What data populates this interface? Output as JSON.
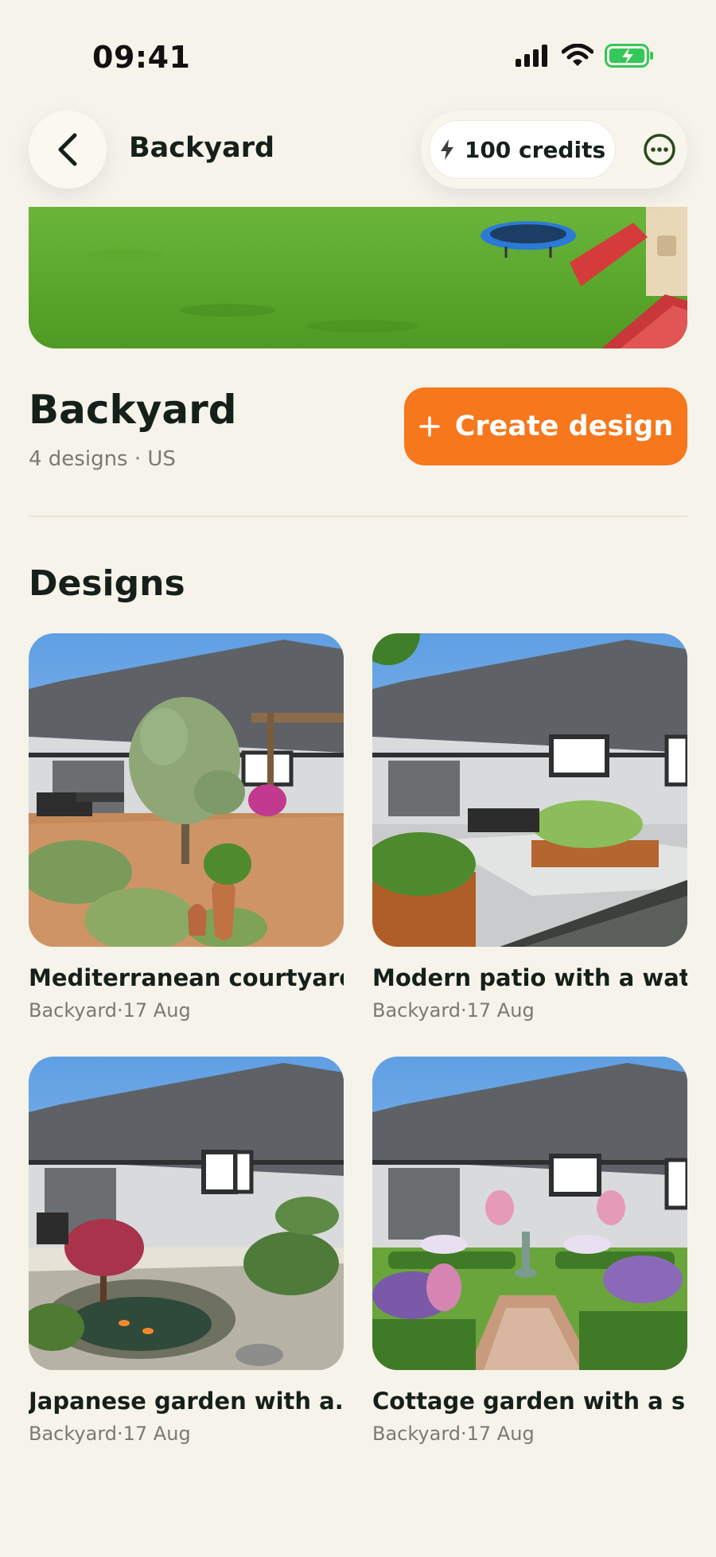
{
  "status_bar": {
    "time": "09:41"
  },
  "header": {
    "title": "Backyard",
    "credits_label": "100 credits"
  },
  "project": {
    "title": "Backyard",
    "designs_count": "4 designs",
    "separator": "·",
    "region": "US",
    "create_button_label": "Create design"
  },
  "designs_section": {
    "title": "Designs",
    "items": [
      {
        "title": "Mediterranean courtyard",
        "location": "Backyard",
        "date": "17 Aug"
      },
      {
        "title": "Modern patio with a wat...",
        "location": "Backyard",
        "date": "17 Aug"
      },
      {
        "title": "Japanese garden with a...",
        "location": "Backyard",
        "date": "17 Aug"
      },
      {
        "title": "Cottage garden with a s...",
        "location": "Backyard",
        "date": "17 Aug"
      }
    ]
  },
  "colors": {
    "background": "#f6f3ea",
    "accent": "#f6771c",
    "text": "#16201a",
    "muted_text": "#7a7a72",
    "battery": "#34c759"
  },
  "icons": {
    "back": "chevron-left-icon",
    "credits": "lightning-bolt-icon",
    "more": "more-horizontal-circle-icon",
    "create": "plus-icon"
  }
}
